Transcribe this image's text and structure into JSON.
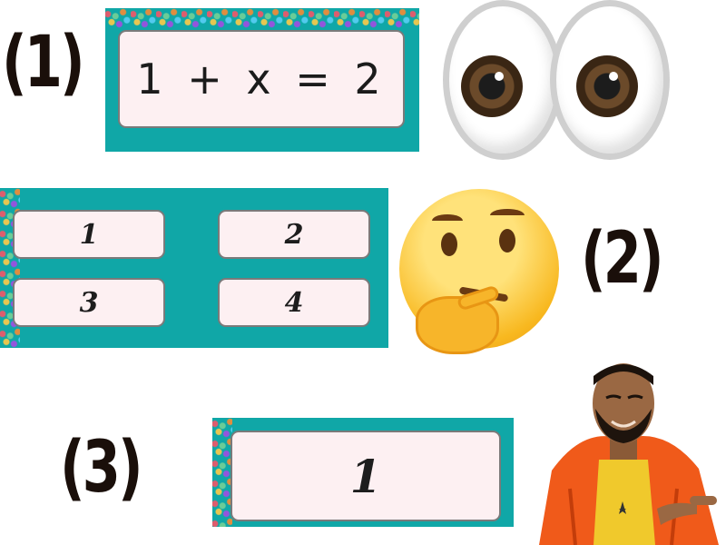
{
  "labels": {
    "step1": "(1)",
    "step2": "(2)",
    "step3": "(3)"
  },
  "panel1": {
    "equation": "1 + x = 2"
  },
  "panel2": {
    "choices": [
      "1",
      "2",
      "3",
      "4"
    ]
  },
  "panel3": {
    "answer": "1"
  },
  "colors": {
    "panel_teal": "#10a7a7",
    "card_fill": "#fdf0f2",
    "label_dark": "#1a0f0a",
    "emoji_yellow": "#f8b81f",
    "jacket_orange": "#f05a1a"
  },
  "icons": {
    "eyes": "eyes-emoji-icon",
    "thinking": "thinking-face-emoji-icon",
    "approving": "approving-person-image"
  }
}
